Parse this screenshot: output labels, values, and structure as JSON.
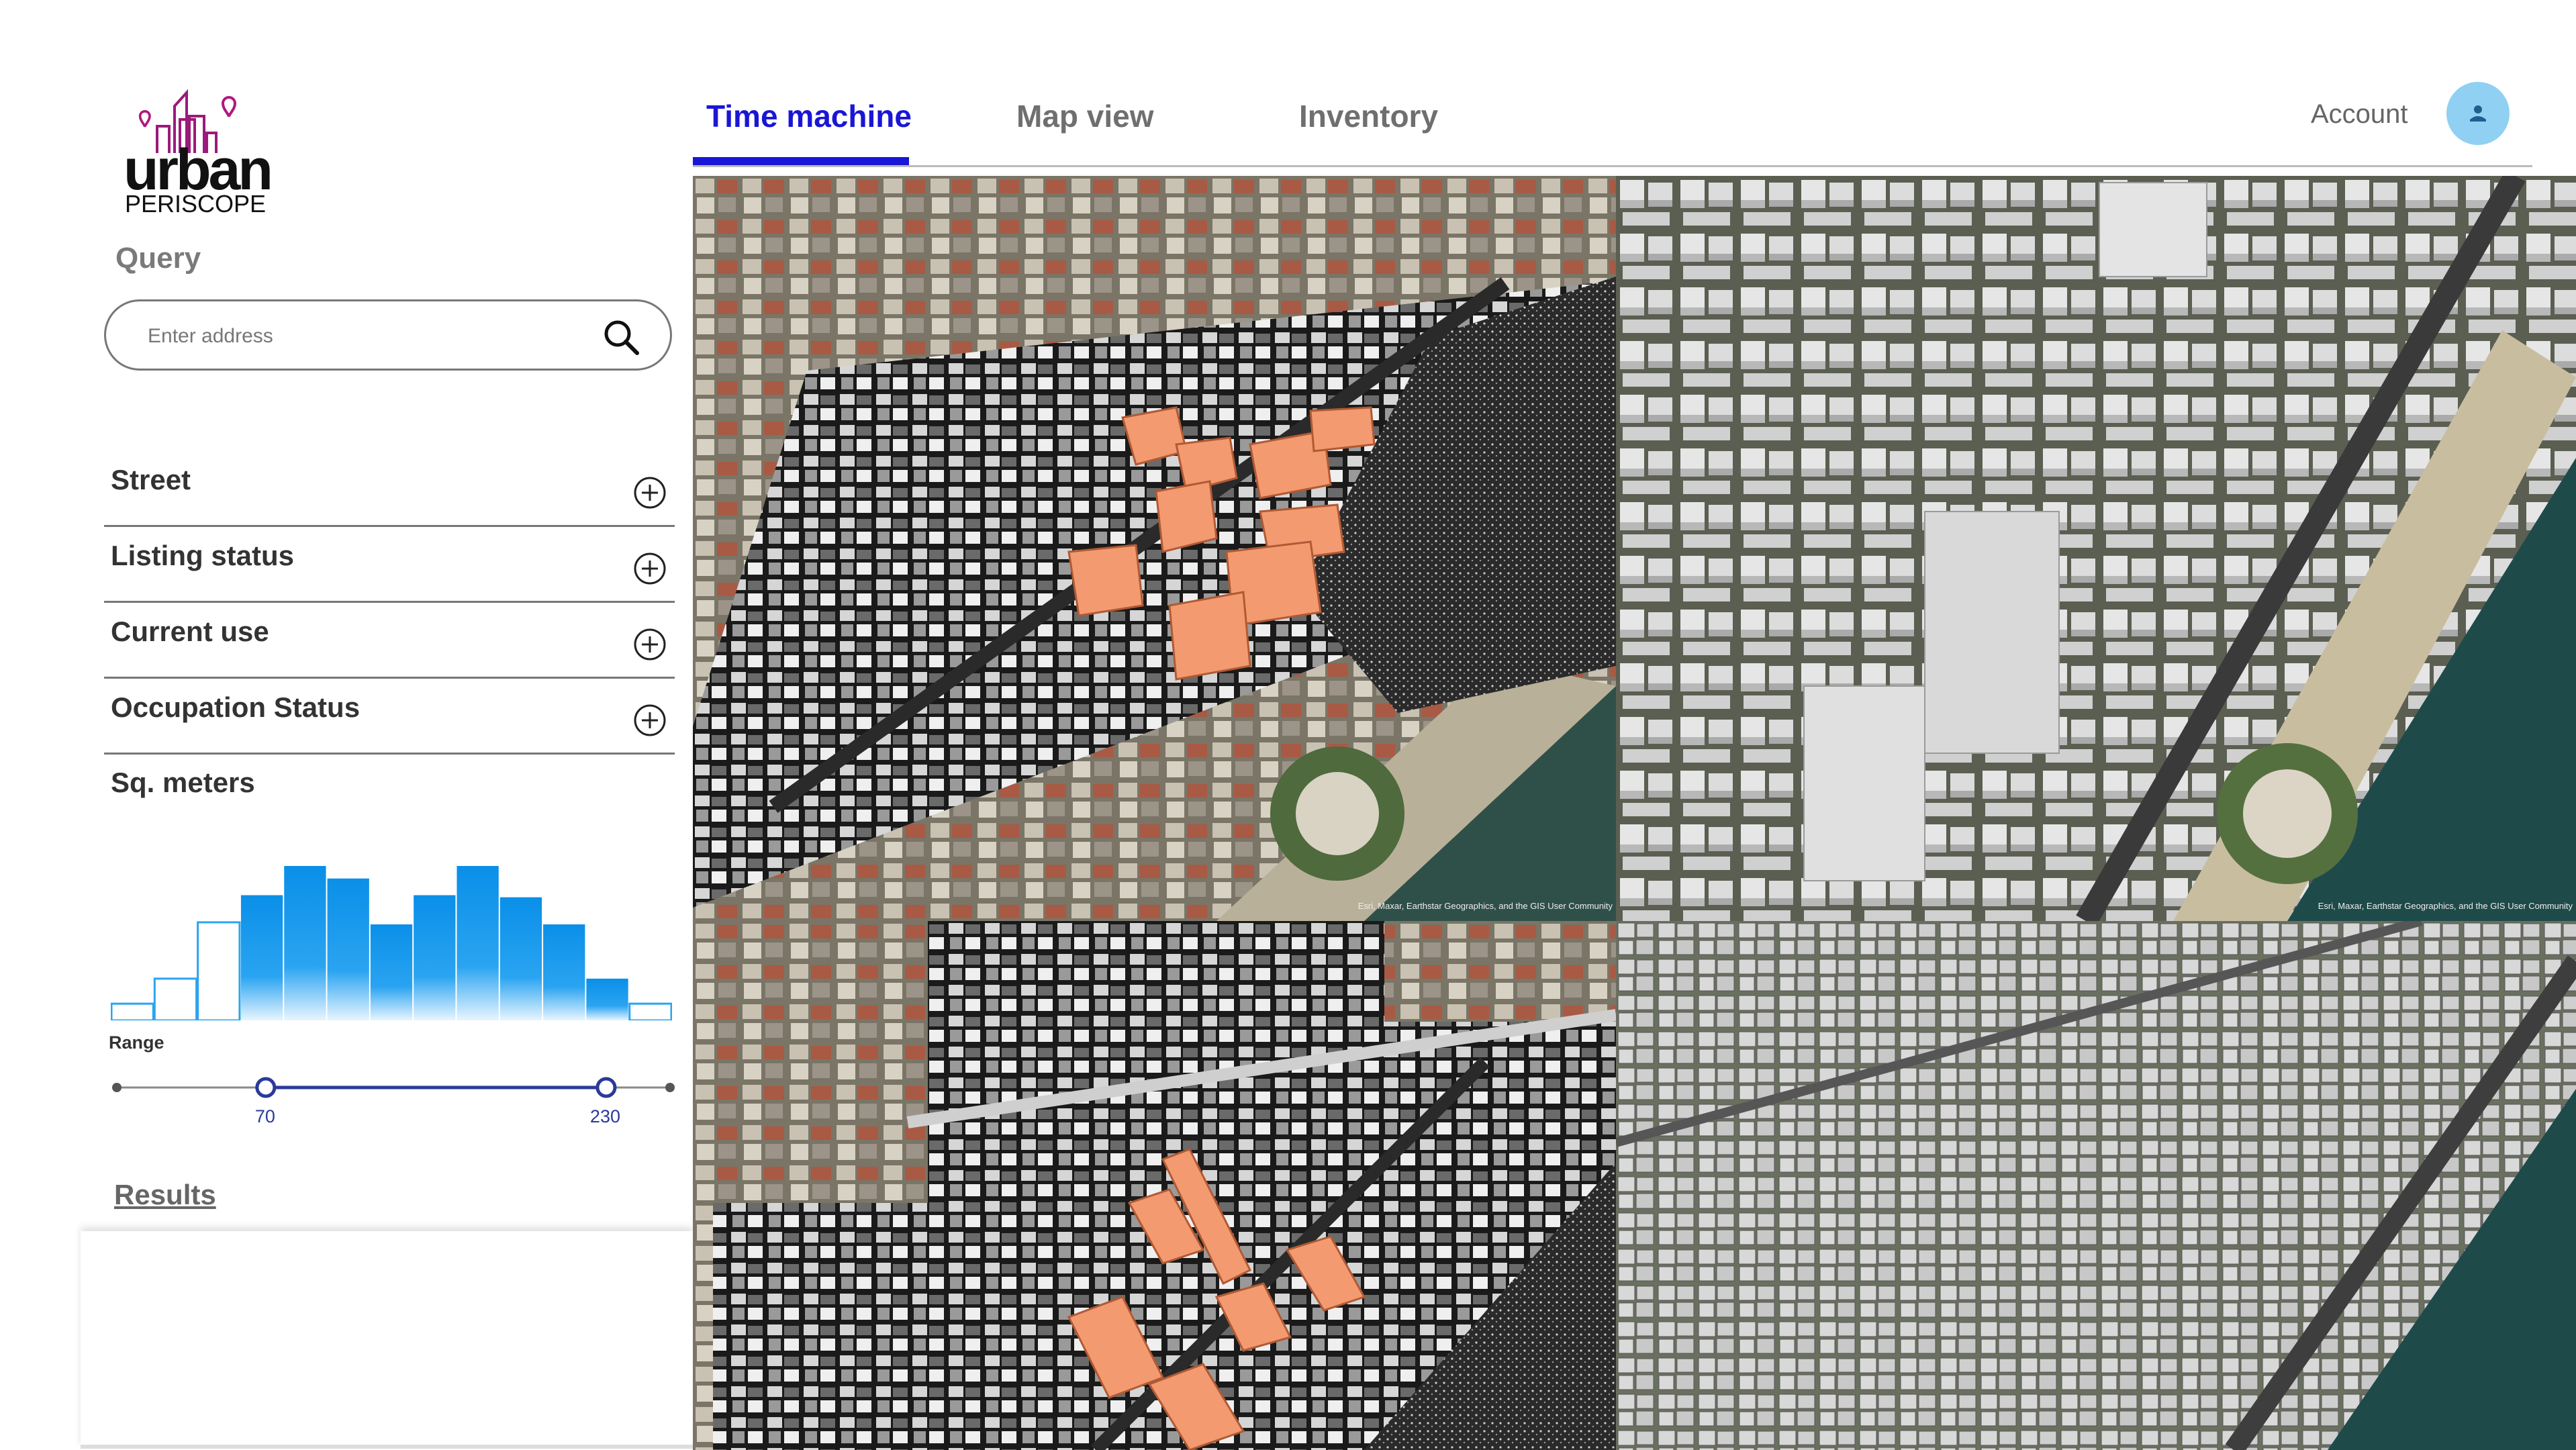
{
  "logo": {
    "word": "urban",
    "sub": "PERISCOPE"
  },
  "query": {
    "label": "Query",
    "search_placeholder": "Enter address",
    "search_value": ""
  },
  "filters": [
    {
      "label": "Street"
    },
    {
      "label": "Listing status"
    },
    {
      "label": "Current use"
    },
    {
      "label": "Occupation Status"
    }
  ],
  "sq_meters": {
    "label": "Sq. meters",
    "histogram_counts": [
      8,
      20,
      47,
      60,
      74,
      68,
      46,
      60,
      74,
      59,
      46,
      20,
      8
    ],
    "range_label": "Range",
    "range_min": 0,
    "range_max": 260,
    "selected_low": 70,
    "selected_high": 230,
    "low_label": "70",
    "high_label": "230"
  },
  "results": {
    "label": "Results"
  },
  "tabs": [
    {
      "label": "Time machine",
      "active": true
    },
    {
      "label": "Map view",
      "active": false
    },
    {
      "label": "Inventory",
      "active": false
    }
  ],
  "account": {
    "label": "Account",
    "icon": "user-icon"
  },
  "map_tiles": [
    {
      "name": "historic-aerial-overlay",
      "credit": "Esri, Maxar, Earthstar Geographics, and the GIS User Community"
    },
    {
      "name": "3d-buildings-view",
      "credit": "Esri, Maxar, Earthstar Geographics, and the GIS User Community"
    },
    {
      "name": "historic-plan-overlay",
      "credit": ""
    },
    {
      "name": "building-footprints-view",
      "credit": ""
    }
  ],
  "colors": {
    "accent": "#1a16d6",
    "highlight_building": "#f39a70",
    "histogram": "#0a8fe8",
    "slider": "#2a3a9a",
    "avatar": "#8fd0f3"
  }
}
